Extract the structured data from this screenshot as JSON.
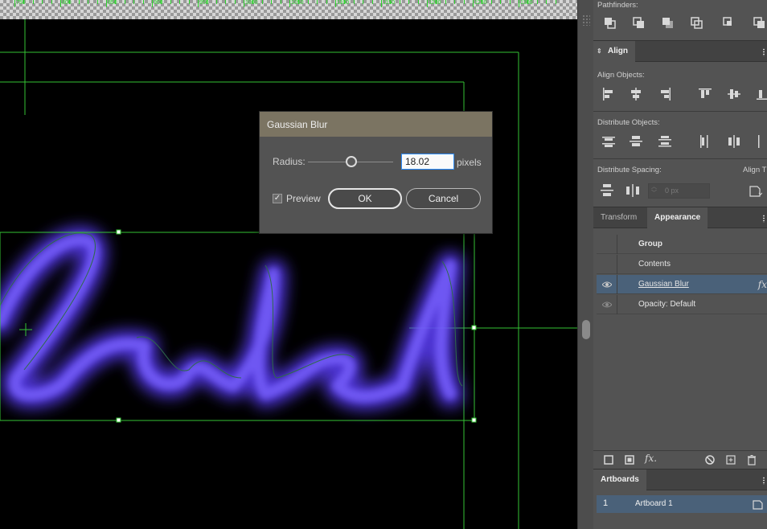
{
  "dialog": {
    "title": "Gaussian Blur",
    "radius_label": "Radius:",
    "radius_value": "18.02",
    "radius_unit": "pixels",
    "preview_label": "Preview",
    "preview_checked": true,
    "ok_label": "OK",
    "cancel_label": "Cancel"
  },
  "panels": {
    "pathfinders": {
      "title": "Pathfinders:"
    },
    "align": {
      "tab": "Align",
      "align_objects_label": "Align Objects:",
      "distribute_objects_label": "Distribute Objects:",
      "distribute_spacing_label": "Distribute Spacing:",
      "align_to_label": "Align T",
      "spacing_value": "0 px"
    },
    "appearance": {
      "tabs": [
        "Transform",
        "Appearance"
      ],
      "active_tab": "Appearance",
      "rows": [
        {
          "label": "Group",
          "eye": false,
          "selected": false
        },
        {
          "label": "Contents",
          "eye": false,
          "selected": false
        },
        {
          "label": "Gaussian Blur",
          "eye": true,
          "selected": true,
          "fx": "fx"
        },
        {
          "label": "Opacity:  Default",
          "eye": true,
          "selected": false
        }
      ],
      "footer_fx": "fx."
    },
    "artboards": {
      "tab": "Artboards",
      "items": [
        {
          "number": "1",
          "name": "Artboard 1"
        }
      ]
    }
  },
  "canvas": {
    "artwork_text": "cheked",
    "glow_color": "#6a50ff",
    "guide_color": "#35c235",
    "ruler_labels": [
      "750",
      "800",
      "850",
      "900",
      "950",
      "1000",
      "1050",
      "1100",
      "1150",
      "1200",
      "1250",
      "1300"
    ]
  },
  "colors": {
    "panel_bg": "#535353",
    "dialog_title_bg": "#7b7462",
    "selection": "#4a6179",
    "input_focus": "#2c8cff"
  }
}
